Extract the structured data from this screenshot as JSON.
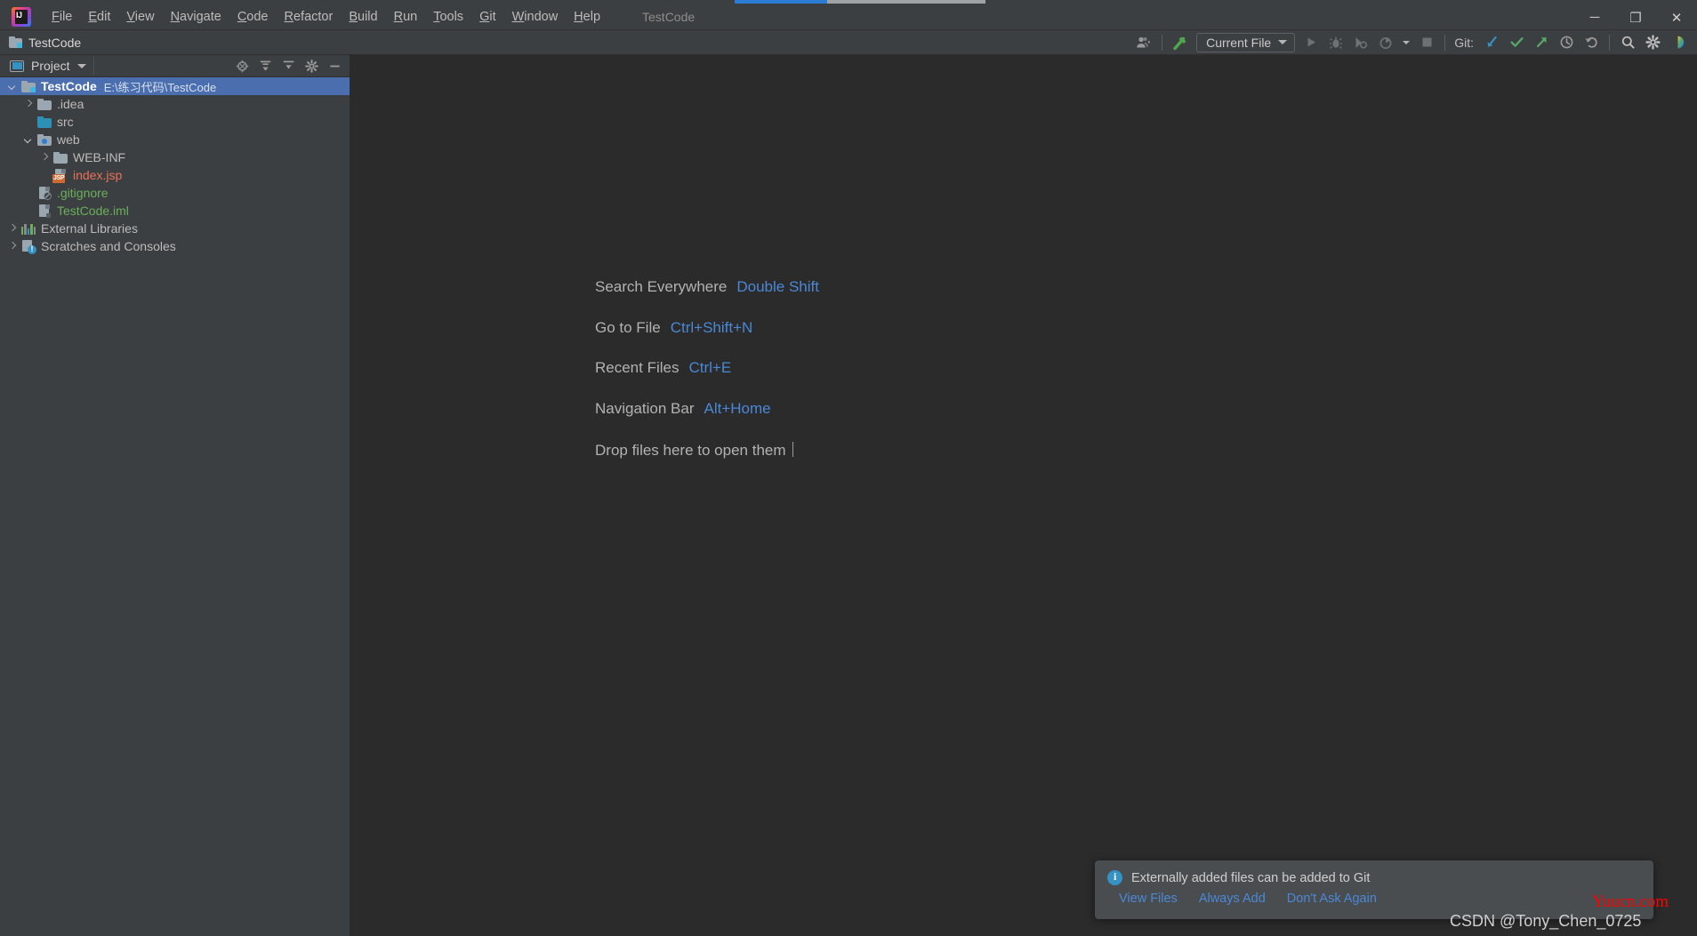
{
  "window": {
    "title": "TestCode",
    "minimize_label": "─",
    "maximize_label": "❐",
    "close_label": "✕",
    "logo_text": "IJ"
  },
  "menubar": {
    "items": [
      {
        "mnemonic": "F",
        "rest": "ile"
      },
      {
        "mnemonic": "E",
        "rest": "dit"
      },
      {
        "mnemonic": "V",
        "rest": "iew"
      },
      {
        "mnemonic": "N",
        "rest": "avigate"
      },
      {
        "mnemonic": "C",
        "rest": "ode"
      },
      {
        "mnemonic": "R",
        "rest": "efactor"
      },
      {
        "mnemonic": "B",
        "rest": "uild"
      },
      {
        "mnemonic": "R",
        "rest": "un"
      },
      {
        "mnemonic": "T",
        "rest": "ools"
      },
      {
        "mnemonic": "G",
        "rest": "it"
      },
      {
        "mnemonic": "W",
        "rest": "indow"
      },
      {
        "mnemonic": "H",
        "rest": "elp"
      }
    ]
  },
  "toolbar": {
    "project_name": "TestCode",
    "run_config": "Current File",
    "git_label": "Git:",
    "icons": {
      "user": "user-dropdown-icon",
      "build": "build-hammer-icon",
      "run": "run-icon",
      "debug": "debug-icon",
      "run_with_coverage": "run-with-coverage-icon",
      "profiler": "profiler-icon",
      "stop": "stop-icon",
      "git_update": "git-update-project-icon",
      "git_commit": "git-commit-icon",
      "git_push": "git-push-icon",
      "git_history": "git-history-icon",
      "git_rollback": "git-rollback-icon",
      "search": "search-icon",
      "settings": "settings-gear-icon",
      "ide_feedback": "ide-color-circle-icon"
    }
  },
  "panel": {
    "title": "Project",
    "tools": [
      {
        "name": "locate-icon"
      },
      {
        "name": "expand-all-icon"
      },
      {
        "name": "collapse-all-icon"
      },
      {
        "name": "settings-gear-icon"
      },
      {
        "name": "hide-panel-icon"
      }
    ]
  },
  "tree": {
    "items": [
      {
        "label": "TestCode",
        "path": "E:\\练习代码\\TestCode",
        "icon": "project-folder-icon",
        "indent": 0,
        "arrow": "down",
        "selected": true,
        "color": "#ffffff"
      },
      {
        "label": ".idea",
        "path": "",
        "icon": "folder-icon",
        "indent": 1,
        "arrow": "right",
        "selected": false,
        "color": "#bbbbbb"
      },
      {
        "label": "src",
        "path": "",
        "icon": "source-folder-icon",
        "indent": 1,
        "arrow": "none",
        "selected": false,
        "color": "#bbbbbb"
      },
      {
        "label": "web",
        "path": "",
        "icon": "web-folder-icon",
        "indent": 1,
        "arrow": "down",
        "selected": false,
        "color": "#bbbbbb"
      },
      {
        "label": "WEB-INF",
        "path": "",
        "icon": "folder-icon",
        "indent": 2,
        "arrow": "right",
        "selected": false,
        "color": "#bbbbbb"
      },
      {
        "label": "index.jsp",
        "path": "",
        "icon": "jsp-file-icon",
        "indent": 2,
        "arrow": "none",
        "selected": false,
        "color": "#e8705a"
      },
      {
        "label": ".gitignore",
        "path": "",
        "icon": "gitignore-file-icon",
        "indent": 1,
        "arrow": "none",
        "selected": false,
        "color": "#6aaf5a"
      },
      {
        "label": "TestCode.iml",
        "path": "",
        "icon": "iml-file-icon",
        "indent": 1,
        "arrow": "none",
        "selected": false,
        "color": "#6aaf5a"
      },
      {
        "label": "External Libraries",
        "path": "",
        "icon": "external-libraries-icon",
        "indent": 0,
        "arrow": "right",
        "selected": false,
        "color": "#bbbbbb"
      },
      {
        "label": "Scratches and Consoles",
        "path": "",
        "icon": "scratches-icon",
        "indent": 0,
        "arrow": "right",
        "selected": false,
        "color": "#bbbbbb"
      }
    ]
  },
  "editor_hints": [
    {
      "label": "Search Everywhere",
      "key": "Double Shift"
    },
    {
      "label": "Go to File",
      "key": "Ctrl+Shift+N"
    },
    {
      "label": "Recent Files",
      "key": "Ctrl+E"
    },
    {
      "label": "Navigation Bar",
      "key": "Alt+Home"
    },
    {
      "label": "Drop files here to open them",
      "key": ""
    }
  ],
  "notification": {
    "message": "Externally added files can be added to Git",
    "links": [
      "View Files",
      "Always Add",
      "Don't Ask Again"
    ],
    "icon": "info-icon"
  },
  "watermarks": {
    "site": "Yuucn.com",
    "author": "CSDN @Tony_Chen_0725"
  },
  "colors": {
    "accent_blue": "#4a88d6",
    "selection_blue": "#4b6eaf",
    "panel_bg": "#3c3f41",
    "editor_bg": "#2b2b2b",
    "green": "#6aaf5a",
    "jsp_red": "#e8705a",
    "watermark_red": "#ff0000"
  }
}
